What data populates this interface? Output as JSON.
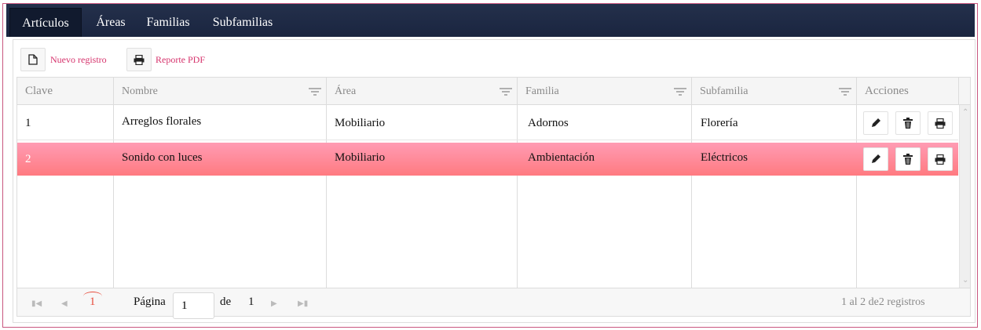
{
  "tabs": [
    {
      "label": "Artículos",
      "active": true
    },
    {
      "label": "Áreas"
    },
    {
      "label": "Familias"
    },
    {
      "label": "Subfamilias"
    }
  ],
  "toolbar": {
    "new_label": "Nuevo registro",
    "pdf_label": "Reporte PDF"
  },
  "grid": {
    "columns": [
      "Clave",
      "Nombre",
      "Área",
      "Familia",
      "Subfamilia",
      "Acciones"
    ],
    "rows": [
      {
        "clave": "1",
        "nombre": "Arreglos florales",
        "area": "Mobiliario",
        "familia": "Adornos",
        "subfamilia": "Florería"
      },
      {
        "clave": "2",
        "nombre": "Sonido con luces",
        "area": "Mobiliario",
        "familia": "Ambientación",
        "subfamilia": "Eléctricos",
        "selected": true
      }
    ]
  },
  "pager": {
    "current_page": "1",
    "page_label": "Página",
    "page_input": "1",
    "of_label": "de",
    "total_pages": "1",
    "summary": "1 al 2 de2 registros"
  },
  "colors": {
    "tabbar": "#1f2a44",
    "accent": "#d6336c",
    "selected_row": "#ff8a9a"
  }
}
